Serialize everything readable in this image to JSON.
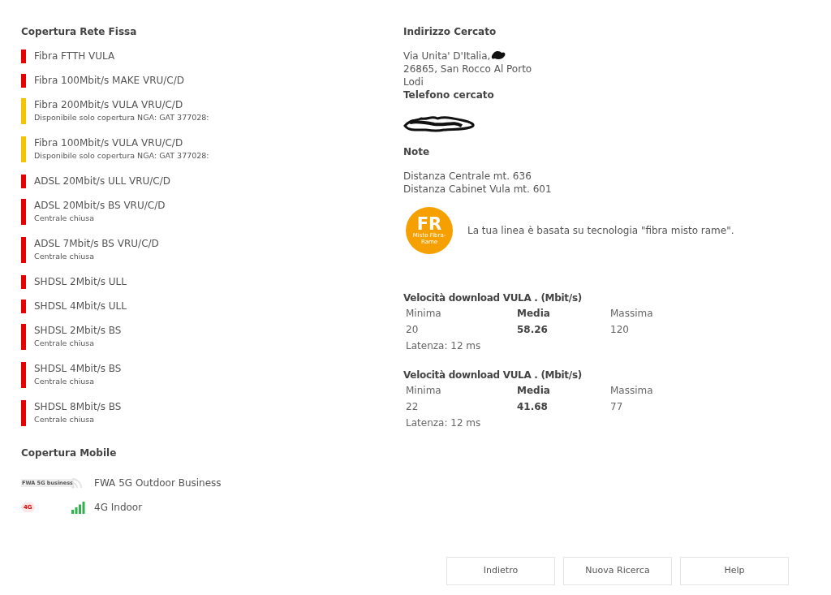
{
  "fixed": {
    "title": "Copertura Rete Fissa",
    "items": [
      {
        "name": "Fibra FTTH VULA",
        "color": "#e60000"
      },
      {
        "name": "Fibra 100Mbit/s MAKE VRU/C/D",
        "color": "#e60000"
      },
      {
        "name": "Fibra 200Mbit/s VULA VRU/C/D",
        "note": "Disponibile solo copertura NGA: GAT 377028:",
        "color": "#f5c400"
      },
      {
        "name": "Fibra 100Mbit/s VULA VRU/C/D",
        "note": "Disponibile solo copertura NGA: GAT 377028:",
        "color": "#f5c400"
      },
      {
        "name": "ADSL 20Mbit/s ULL VRU/C/D",
        "color": "#e60000"
      },
      {
        "name": "ADSL 20Mbit/s BS VRU/C/D",
        "note": "Centrale chiusa",
        "color": "#e60000"
      },
      {
        "name": "ADSL 7Mbit/s BS VRU/C/D",
        "note": "Centrale chiusa",
        "color": "#e60000"
      },
      {
        "name": "SHDSL 2Mbit/s ULL",
        "color": "#e60000"
      },
      {
        "name": "SHDSL 4Mbit/s ULL",
        "color": "#e60000"
      },
      {
        "name": "SHDSL 2Mbit/s BS",
        "note": "Centrale chiusa",
        "color": "#e60000"
      },
      {
        "name": "SHDSL 4Mbit/s BS",
        "note": "Centrale chiusa",
        "color": "#e60000"
      },
      {
        "name": "SHDSL 8Mbit/s BS",
        "note": "Centrale chiusa",
        "color": "#e60000"
      }
    ]
  },
  "mobile": {
    "title": "Copertura Mobile",
    "items": [
      {
        "badge": "FWA 5G business",
        "kind": "wifi",
        "available": false,
        "name": "FWA 5G Outdoor Business"
      },
      {
        "badge": "4G",
        "kind": "cellular",
        "available": true,
        "name": "4G Indoor"
      }
    ]
  },
  "address": {
    "title": "Indirizzo Cercato",
    "lines": [
      "Via Unita' D'Italia,",
      "26865, San Rocco Al Porto",
      "Lodi"
    ]
  },
  "phone": {
    "title": "Telefono cercato"
  },
  "notes": {
    "title": "Note",
    "lines": [
      "Distanza Centrale mt. 636",
      "Distanza Cabinet Vula mt. 601"
    ]
  },
  "technology": {
    "badge": "FR",
    "badge_caption": "Misto Fibra-Rame",
    "text": "La tua linea è basata su tecnologia \"fibra misto rame\"."
  },
  "speeds": [
    {
      "title": "Velocità download VULA . (Mbit/s)",
      "columns": [
        {
          "label": "Minima",
          "value": "20",
          "bold": false
        },
        {
          "label": "Media",
          "value": "58.26",
          "bold": true
        },
        {
          "label": "Massima",
          "value": "120",
          "bold": false
        }
      ],
      "latency": "Latenza: 12 ms"
    },
    {
      "title": "Velocità download VULA . (Mbit/s)",
      "columns": [
        {
          "label": "Minima",
          "value": "22",
          "bold": false
        },
        {
          "label": "Media",
          "value": "41.68",
          "bold": true
        },
        {
          "label": "Massima",
          "value": "77",
          "bold": false
        }
      ],
      "latency": "Latenza: 12 ms"
    }
  ],
  "buttons": [
    "Indietro",
    "Nuova Ricerca",
    "Help"
  ]
}
